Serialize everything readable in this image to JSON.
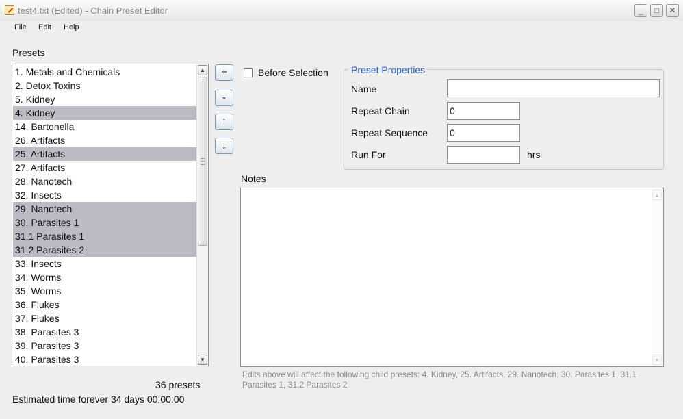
{
  "window": {
    "title": "test4.txt (Edited) - Chain Preset Editor",
    "minimize_glyph": "_",
    "maximize_glyph": "□",
    "close_glyph": "✕"
  },
  "menu": [
    "File",
    "Edit",
    "Help"
  ],
  "presets": {
    "label": "Presets",
    "items": [
      {
        "text": "1. Metals and Chemicals",
        "selected": false
      },
      {
        "text": "2. Detox Toxins",
        "selected": false
      },
      {
        "text": "5. Kidney",
        "selected": false
      },
      {
        "text": "4. Kidney",
        "selected": true
      },
      {
        "text": "14. Bartonella",
        "selected": false
      },
      {
        "text": "26. Artifacts",
        "selected": false
      },
      {
        "text": "25. Artifacts",
        "selected": true
      },
      {
        "text": "27. Artifacts",
        "selected": false
      },
      {
        "text": "28. Nanotech",
        "selected": false
      },
      {
        "text": "32. Insects",
        "selected": false
      },
      {
        "text": "29. Nanotech",
        "selected": true
      },
      {
        "text": "30. Parasites 1",
        "selected": true
      },
      {
        "text": "31.1 Parasites 1",
        "selected": true
      },
      {
        "text": "31.2 Parasites 2",
        "selected": true
      },
      {
        "text": "33. Insects",
        "selected": false
      },
      {
        "text": "34. Worms",
        "selected": false
      },
      {
        "text": "35. Worms",
        "selected": false
      },
      {
        "text": "36. Flukes",
        "selected": false
      },
      {
        "text": "37. Flukes",
        "selected": false
      },
      {
        "text": "38. Parasites 3",
        "selected": false
      },
      {
        "text": "39. Parasites 3",
        "selected": false
      },
      {
        "text": "40. Parasites 3",
        "selected": false
      }
    ],
    "count": "36 presets",
    "estimated_time": "Estimated time forever 34 days 00:00:00",
    "scroll_up_glyph": "▲",
    "scroll_down_glyph": "▼"
  },
  "toolbar": {
    "add": "+",
    "remove": "-",
    "move_up": "↑",
    "move_down": "↓"
  },
  "before_selection": {
    "label": "Before Selection",
    "checked": false
  },
  "properties": {
    "legend": "Preset Properties",
    "name_label": "Name",
    "name_value": "",
    "repeat_chain_label": "Repeat Chain",
    "repeat_chain_value": "0",
    "repeat_sequence_label": "Repeat Sequence",
    "repeat_sequence_value": "0",
    "run_for_label": "Run For",
    "run_for_value": "",
    "run_for_unit": "hrs"
  },
  "notes": {
    "label": "Notes",
    "value": "",
    "scroll_up_glyph": "▲",
    "scroll_down_glyph": "▼",
    "child_hint": "Edits above will affect the following child presets: 4. Kidney, 25. Artifacts, 29. Nanotech, 30. Parasites 1, 31.1 Parasites 1, 31.2 Parasites 2"
  }
}
